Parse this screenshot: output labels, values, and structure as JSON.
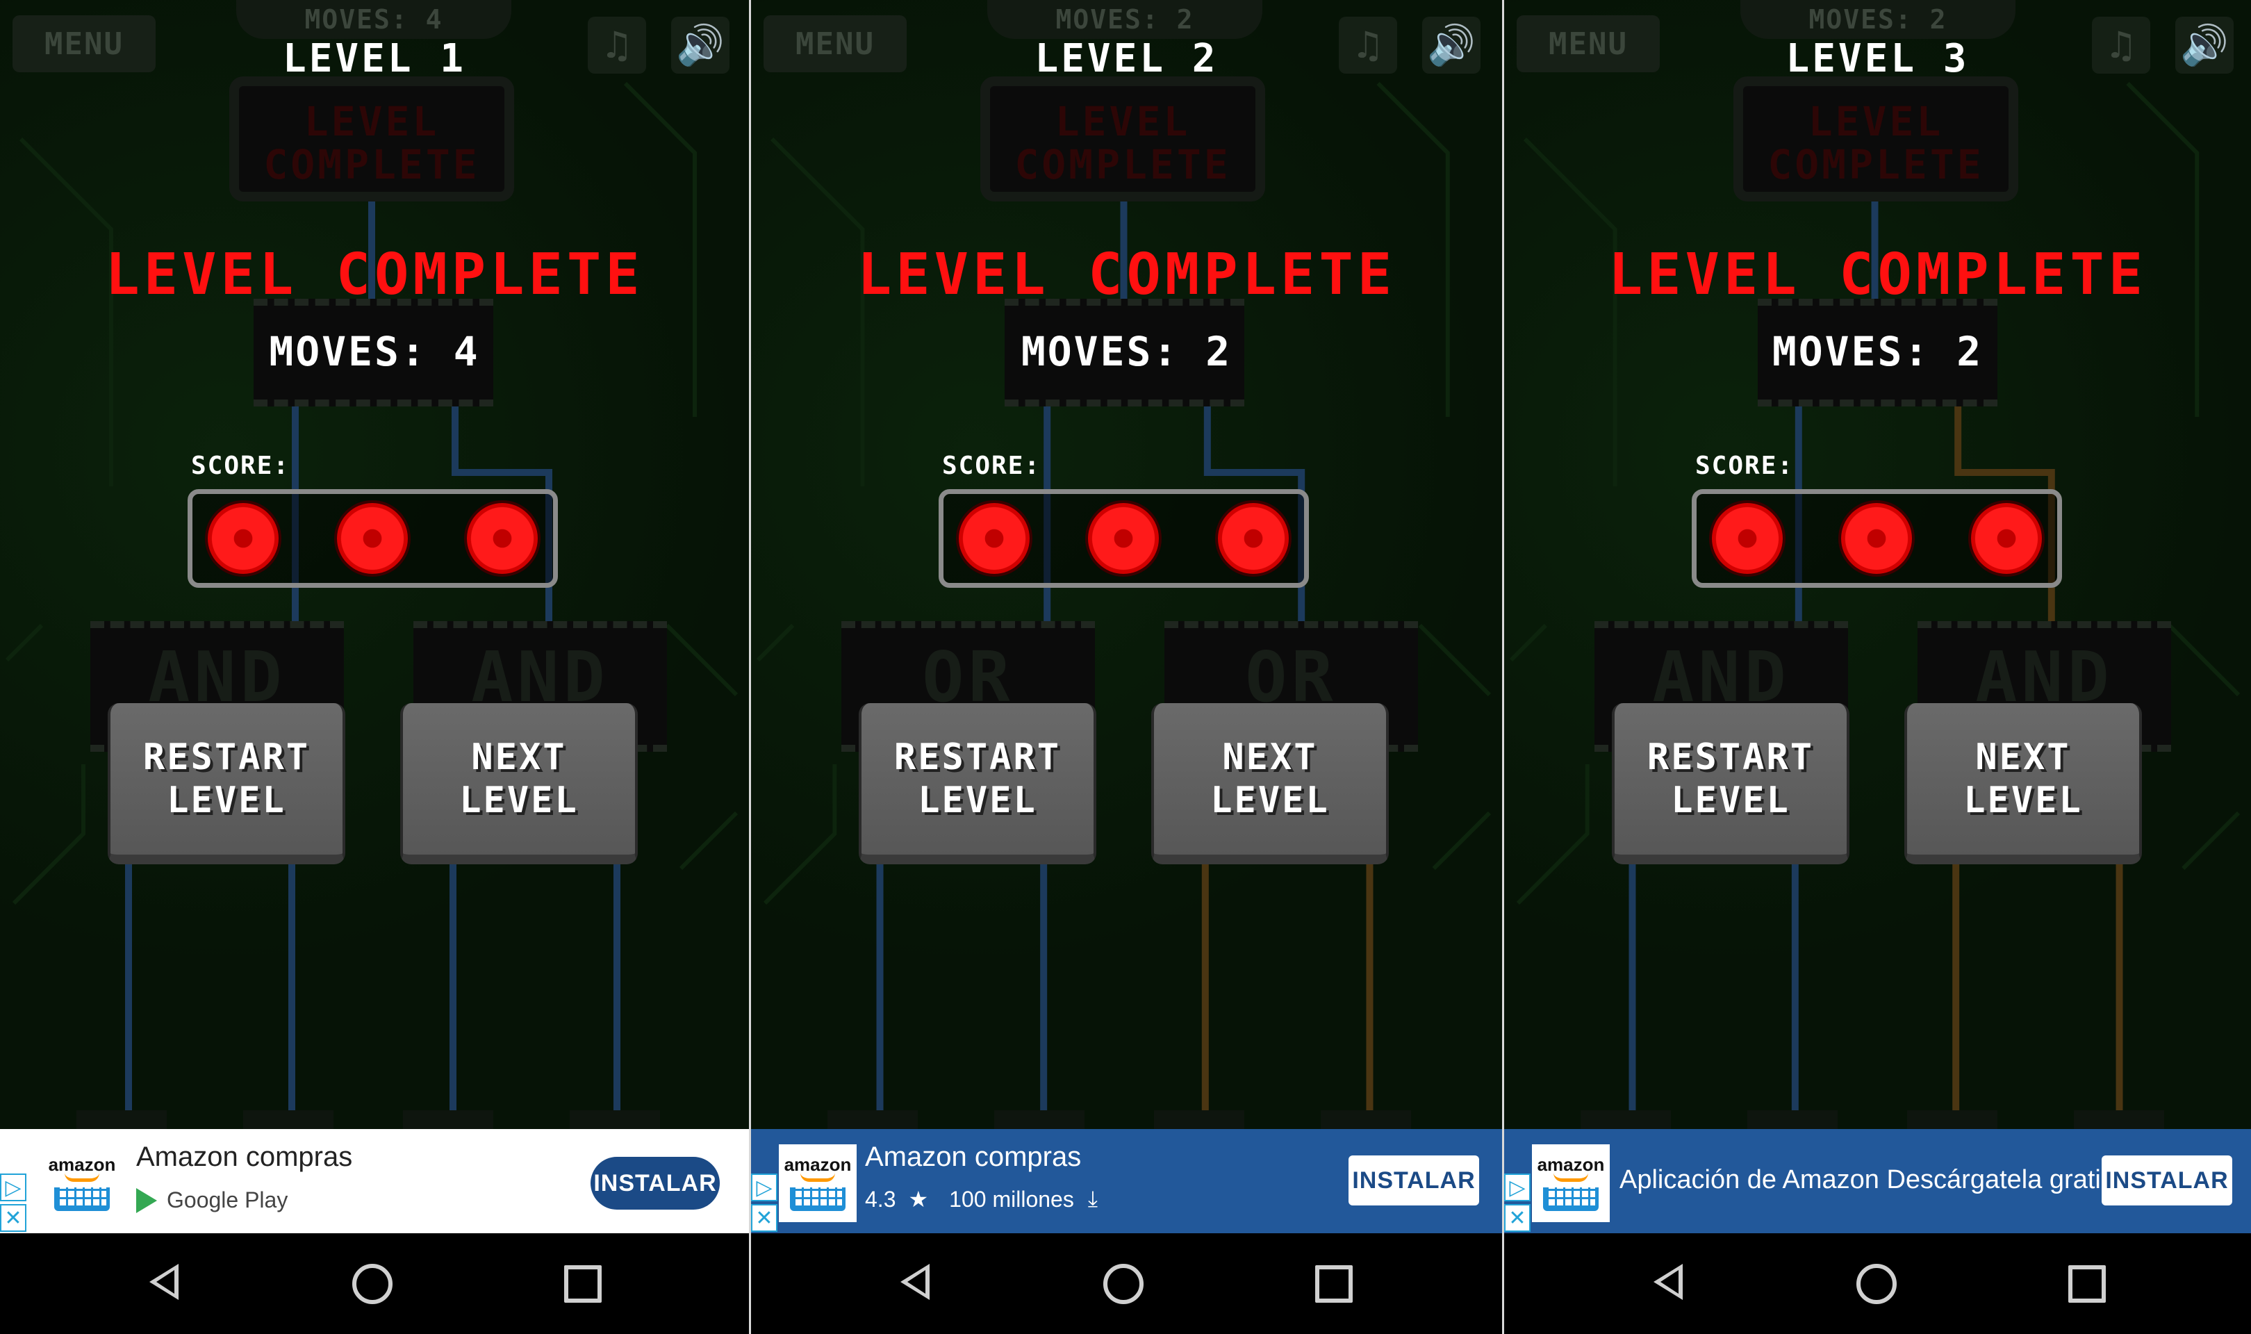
{
  "screens": [
    {
      "top_tab": "MOVES: 4",
      "menu": "MENU",
      "level_title": "LEVEL 1",
      "lc_box_line1": "LEVEL",
      "lc_box_line2": "COMPLETE",
      "heading": "LEVEL COMPLETE",
      "moves": "MOVES: 4",
      "score_label": "SCORE:",
      "stars_earned": 3,
      "gates": [
        "AND",
        "AND"
      ],
      "restart_l1": "RESTART",
      "restart_l2": "LEVEL",
      "next_l1": "NEXT",
      "next_l2": "LEVEL",
      "ad": {
        "style": "white",
        "title": "Amazon compras",
        "sub": "Google Play",
        "install": "INSTALAR",
        "logo_text": "amazon"
      }
    },
    {
      "top_tab": "MOVES: 2",
      "menu": "MENU",
      "level_title": "LEVEL 2",
      "lc_box_line1": "LEVEL",
      "lc_box_line2": "COMPLETE",
      "heading": "LEVEL COMPLETE",
      "moves": "MOVES: 2",
      "score_label": "SCORE:",
      "stars_earned": 3,
      "gates": [
        "OR",
        "OR"
      ],
      "restart_l1": "RESTART",
      "restart_l2": "LEVEL",
      "next_l1": "NEXT",
      "next_l2": "LEVEL",
      "ad": {
        "style": "blue",
        "title": "Amazon compras",
        "rating": "4.3",
        "downloads": "100 millones",
        "install": "INSTALAR",
        "logo_text": "amazon"
      }
    },
    {
      "top_tab": "MOVES: 2",
      "menu": "MENU",
      "level_title": "LEVEL 3",
      "lc_box_line1": "LEVEL",
      "lc_box_line2": "COMPLETE",
      "heading": "LEVEL COMPLETE",
      "moves": "MOVES: 2",
      "score_label": "SCORE:",
      "stars_earned": 3,
      "gates": [
        "AND",
        "AND"
      ],
      "restart_l1": "RESTART",
      "restart_l2": "LEVEL",
      "next_l1": "NEXT",
      "next_l2": "LEVEL",
      "ad": {
        "style": "blue",
        "title": "Aplicación de Amazon Descárgatela gratis",
        "install": "INSTALAR",
        "logo_text": "amazon"
      }
    }
  ],
  "icons": {
    "music": "music-note-icon",
    "sound": "speaker-icon",
    "ad_choices": "ad-choices-icon",
    "ad_close": "close-icon",
    "star": "star-icon",
    "download": "download-icon",
    "nav_back": "back-icon",
    "nav_home": "home-icon",
    "nav_recent": "recent-apps-icon"
  },
  "colors": {
    "heading_red": "#ff1010",
    "score_red": "#ff1a1a",
    "ad_blue": "#22589a",
    "trace_blue": "#1c3a5c",
    "trace_orange": "#4a3512"
  }
}
